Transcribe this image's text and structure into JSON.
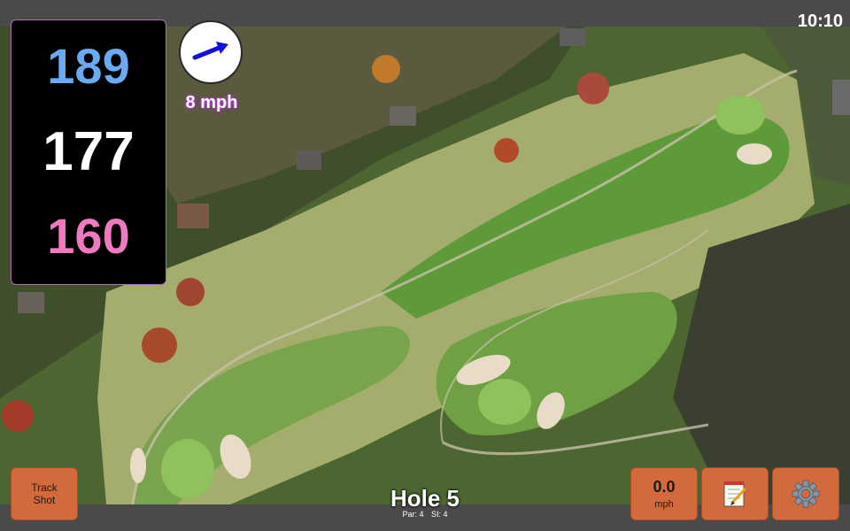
{
  "status": {
    "time": "10:10"
  },
  "distances": {
    "back": "189",
    "middle": "177",
    "front": "160"
  },
  "wind": {
    "speed_label": "8 mph",
    "direction_icon": "wind-arrow-icon"
  },
  "hole": {
    "title": "Hole 5",
    "par": "Par: 4",
    "stroke_index": "SI: 4"
  },
  "buttons": {
    "track_shot_line1": "Track",
    "track_shot_line2": "Shot",
    "speed_value": "0.0",
    "speed_unit": "mph",
    "notes_icon": "notepad-icon",
    "settings_icon": "gear-icon"
  },
  "colors": {
    "back_distance": "#6aaaf0",
    "middle_distance": "#ffffff",
    "front_distance": "#f07ac0",
    "button": "#d26a3c",
    "panel": "#000000"
  }
}
